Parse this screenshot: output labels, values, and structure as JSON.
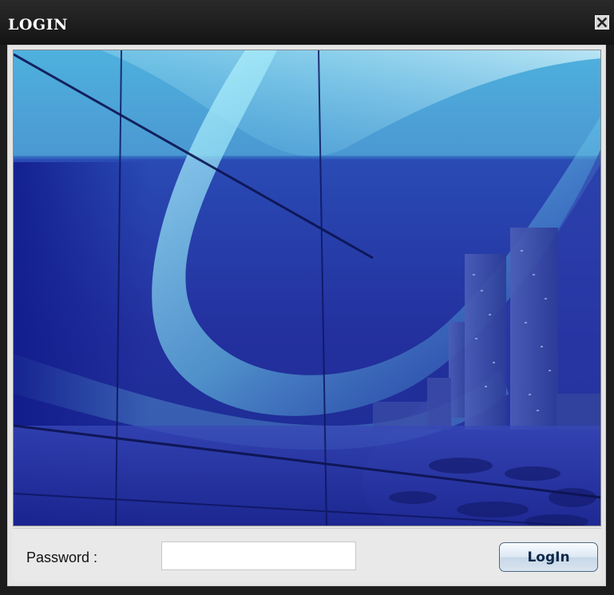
{
  "window": {
    "title": "LOGIN",
    "close_icon": "close-icon"
  },
  "banner": {
    "description_icon": "city-skyline-banner-image",
    "colors": {
      "deep_blue": "#1d2c9c",
      "cyan": "#6fd2ea"
    }
  },
  "login": {
    "password_label": "Password :",
    "password_value": "",
    "password_placeholder": "",
    "login_button_label": "LogIn"
  }
}
